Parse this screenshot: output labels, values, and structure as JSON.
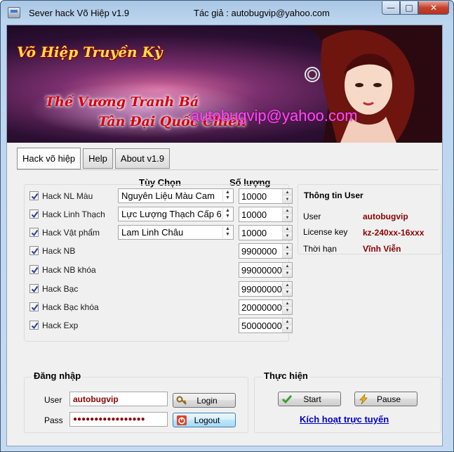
{
  "window": {
    "title": "Sever hack Võ Hiệp v1.9",
    "author": "Tác giả  : autobugvip@yahoo.com",
    "buttons": {
      "minimize": "—",
      "maximize": "□",
      "close": "✕"
    }
  },
  "banner": {
    "logo": "Võ Hiệp Truyền Kỳ",
    "slogan_line1": "Thế Vương Tranh Bá",
    "slogan_line2": "Tân Đại Quốc Chiến",
    "email": "autobugvip@yahoo.com"
  },
  "tabs": [
    {
      "label": "Hack võ hiệp",
      "active": true
    },
    {
      "label": "Help",
      "active": false
    },
    {
      "label": "About v1.9",
      "active": false
    }
  ],
  "options": {
    "header_choice": "Tùy Chọn",
    "header_quantity": "Số lượng",
    "rows": [
      {
        "label": "Hack NL Màu",
        "checked": true,
        "choice": "Nguyên Liệu Màu Cam",
        "quantity": "10000"
      },
      {
        "label": "Hack Linh Thạch",
        "checked": true,
        "choice": "Lực Lượng Thạch Cấp 6",
        "quantity": "10000"
      },
      {
        "label": "Hack Vật phẩm",
        "checked": true,
        "choice": "Lam Linh Châu",
        "quantity": "10000"
      },
      {
        "label": "Hack NB",
        "checked": true,
        "quantity": "9900000"
      },
      {
        "label": "Hack NB khóa",
        "checked": true,
        "quantity": "99000000"
      },
      {
        "label": "Hack Bạc",
        "checked": true,
        "quantity": "99000000"
      },
      {
        "label": "Hack Bạc khóa",
        "checked": true,
        "quantity": "20000000"
      },
      {
        "label": "Hack Exp",
        "checked": true,
        "quantity": "50000000"
      }
    ]
  },
  "user_info": {
    "title": "Thông tin User",
    "user_label": "User",
    "user_value": "autobugvip",
    "license_label": "License key",
    "license_value": "kz-240xx-16xxx",
    "expiry_label": "Thời hạn",
    "expiry_value": "Vĩnh Viễn"
  },
  "login": {
    "title": "Đăng nhập",
    "user_label": "User",
    "user_value": "autobugvip",
    "pass_label": "Pass",
    "pass_value": "●●●●●●●●●●●●●●●●●",
    "login_button": "Login",
    "logout_button": "Logout"
  },
  "actions": {
    "title": "Thực hiện",
    "start_button": "Start",
    "pause_button": "Pause",
    "activate_link": "Kích hoạt trực tuyến"
  },
  "colors": {
    "value_text": "#8b0000",
    "link": "#0000cc",
    "title_bar": "#bcd5ee"
  }
}
